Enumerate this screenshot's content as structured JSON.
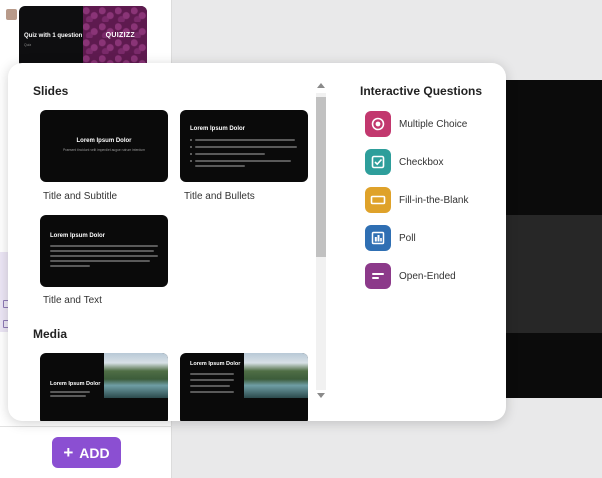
{
  "sidebar": {
    "thumbnail": {
      "title": "Quiz with 1 question",
      "subtitle": "Quiz",
      "logo": "QUIZIZZ"
    },
    "add_button": {
      "icon": "plus-icon",
      "label": "ADD",
      "color": "#8b4fd2"
    }
  },
  "modal": {
    "slides_heading": "Slides",
    "slide_templates": [
      {
        "caption": "Title and Subtitle",
        "title": "Lorem Ipsum Dolor",
        "subtitle": "Praesent tincidunt velit imperdiet augue rutrum interdum"
      },
      {
        "caption": "Title and Bullets",
        "title": "Lorem Ipsum Dolor"
      },
      {
        "caption": "Title and Text",
        "title": "Lorem Ipsum Dolor"
      }
    ],
    "media_heading": "Media",
    "media_templates": [
      {
        "title": "Lorem Ipsum Dolor"
      },
      {
        "title": "Lorem Ipsum Dolor"
      }
    ],
    "interactive_heading": "Interactive Questions",
    "interactive_questions": [
      {
        "label": "Multiple Choice",
        "icon": "radio-button-icon",
        "color": "#c2386e"
      },
      {
        "label": "Checkbox",
        "icon": "checkbox-icon",
        "color": "#2e9e9b"
      },
      {
        "label": "Fill-in-the-Blank",
        "icon": "blank-field-icon",
        "color": "#dfa22a"
      },
      {
        "label": "Poll",
        "icon": "poll-icon",
        "color": "#2f6fb3"
      },
      {
        "label": "Open-Ended",
        "icon": "open-ended-icon",
        "color": "#8c3a8a"
      }
    ]
  }
}
